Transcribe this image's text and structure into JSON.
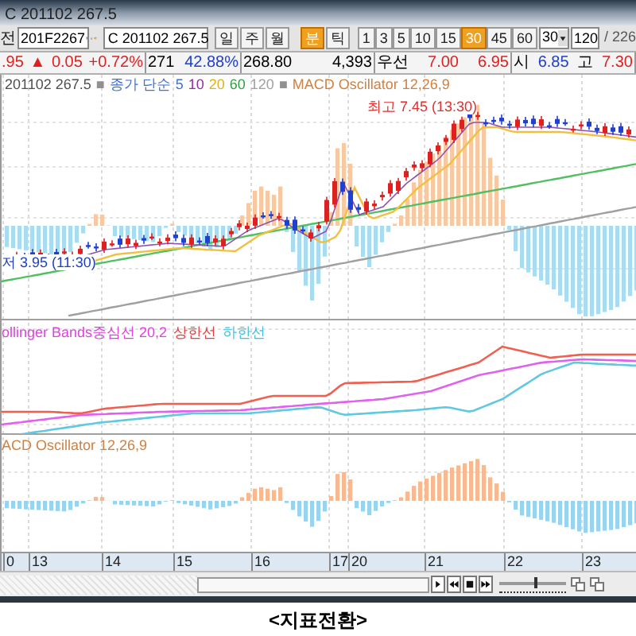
{
  "window": {
    "title": "C 201102 267.5"
  },
  "toolbar": {
    "cut_label": "전",
    "code_combo": "201F2267",
    "symbol_field": "C 201102 267.5",
    "period_buttons": [
      {
        "label": "일",
        "selected": false
      },
      {
        "label": "주",
        "selected": false
      },
      {
        "label": "월",
        "selected": false
      }
    ],
    "unit_buttons": [
      {
        "label": "분",
        "selected": true
      },
      {
        "label": "틱",
        "selected": false
      }
    ],
    "interval_buttons": [
      {
        "label": "1",
        "selected": false
      },
      {
        "label": "3",
        "selected": false
      },
      {
        "label": "5",
        "selected": false
      },
      {
        "label": "10",
        "selected": false
      },
      {
        "label": "15",
        "selected": false
      },
      {
        "label": "30",
        "selected": true
      },
      {
        "label": "45",
        "selected": false
      },
      {
        "label": "60",
        "selected": false
      }
    ],
    "interval_combo": "30",
    "count_field": "120",
    "count_total": "/ 226"
  },
  "quote": [
    [
      {
        "text": ".95",
        "color": "#e02020"
      },
      {
        "text": "▲",
        "color": "#e02020"
      },
      {
        "text": "0.05",
        "color": "#e02020"
      },
      {
        "text": "+0.72%",
        "color": "#e02020"
      }
    ],
    [
      {
        "text": "271",
        "color": "#000000"
      },
      {
        "text": "42.88%",
        "color": "#2040d0"
      }
    ],
    [
      {
        "text": "268.80",
        "color": "#000000"
      },
      {
        "text": "4,393",
        "color": "#000000"
      }
    ],
    [
      {
        "text": "우선",
        "color": "#000000"
      },
      {
        "text": "7.00",
        "color": "#e02020"
      },
      {
        "text": "6.95",
        "color": "#e02020"
      }
    ],
    [
      {
        "text": "시",
        "color": "#000000"
      },
      {
        "text": "6.85",
        "color": "#2040d0"
      },
      {
        "text": "고",
        "color": "#000000"
      },
      {
        "text": "7.30",
        "color": "#e02020"
      }
    ]
  ],
  "price_legend": [
    {
      "text": "201102 267.5",
      "color": "#505050"
    },
    {
      "text": "■",
      "color": "#909090"
    },
    {
      "text": "종가 단순",
      "color": "#4070d0"
    },
    {
      "text": "5",
      "color": "#4070d0"
    },
    {
      "text": "10",
      "color": "#9030a0"
    },
    {
      "text": "20",
      "color": "#e0b020"
    },
    {
      "text": "60",
      "color": "#30a040"
    },
    {
      "text": "120",
      "color": "#a0a0a0"
    },
    {
      "text": "■",
      "color": "#909090"
    },
    {
      "text": "MACD Oscillator 12,26,9",
      "color": "#d08040"
    }
  ],
  "annotations": [
    {
      "kind": "high",
      "text": "최고 7.45 (13:30)"
    },
    {
      "kind": "low",
      "text": "저 3.95 (11:30)"
    }
  ],
  "bollinger_legend": [
    {
      "text": "ollinger Bands중심선 20,2",
      "color": "#e040e0"
    },
    {
      "text": "상한선",
      "color": "#e04040"
    },
    {
      "text": "하한선",
      "color": "#40c0e0"
    }
  ],
  "macd_legend": "ACD Oscillator 12,26,9",
  "x_axis": [
    "0",
    "13",
    "14",
    "15",
    "16",
    "17",
    "20",
    "21",
    "22",
    "23"
  ],
  "zoom_slider": {
    "level": 0.55
  },
  "caption": "<지표전환>"
}
